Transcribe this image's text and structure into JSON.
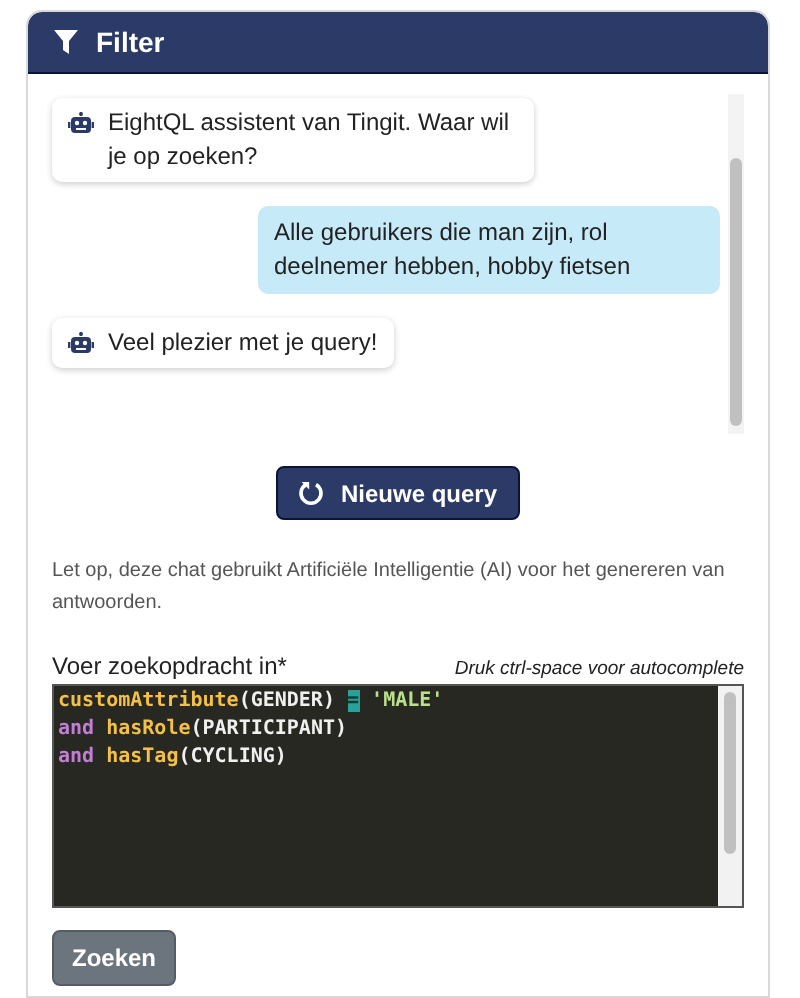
{
  "header": {
    "title": "Filter"
  },
  "chat": {
    "messages": [
      {
        "kind": "bot",
        "text": "EightQL assistent van Tingit. Waar wil je op zoeken?"
      },
      {
        "kind": "user",
        "text": "Alle gebruikers die man zijn, rol deelnemer hebben, hobby fietsen"
      },
      {
        "kind": "bot",
        "text": "Veel plezier met je query!"
      }
    ]
  },
  "new_query_button": {
    "label": "Nieuwe query"
  },
  "disclaimer": "Let op, deze chat gebruikt Artificiële Intelligentie (AI) voor het genereren van antwoorden.",
  "query": {
    "label": "Voer zoekopdracht in*",
    "hint": "Druk ctrl-space voor autocomplete",
    "lines": [
      [
        {
          "text": "customAttribute",
          "kind": "function"
        },
        {
          "text": "(GENDER) ",
          "kind": "plain"
        },
        {
          "text": "=",
          "kind": "operator"
        },
        {
          "text": " 'MALE'",
          "kind": "string"
        }
      ],
      [
        {
          "text": "and ",
          "kind": "keyword"
        },
        {
          "text": "hasRole",
          "kind": "function"
        },
        {
          "text": "(PARTICIPANT)",
          "kind": "plain"
        }
      ],
      [
        {
          "text": "and ",
          "kind": "keyword"
        },
        {
          "text": "hasTag",
          "kind": "function"
        },
        {
          "text": "(CYCLING)",
          "kind": "plain"
        }
      ]
    ]
  },
  "search_button": {
    "label": "Zoeken"
  }
}
